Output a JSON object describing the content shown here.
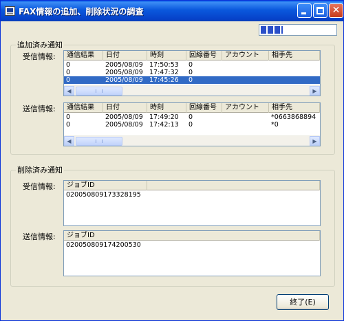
{
  "window": {
    "title": "FAX情報の追加、削除状況の調査"
  },
  "progress": {
    "fraction": 0.3
  },
  "added": {
    "legend": "追加済み通知",
    "received": {
      "label": "受信情報:",
      "columns": [
        "通信結果",
        "日付",
        "時刻",
        "回線番号",
        "アカウント",
        "相手先"
      ],
      "rows": [
        [
          "0",
          "2005/08/09",
          "17:50:53",
          "0",
          "",
          ""
        ],
        [
          "0",
          "2005/08/09",
          "17:47:32",
          "0",
          "",
          ""
        ],
        [
          "0",
          "2005/08/09",
          "17:45:26",
          "0",
          "",
          ""
        ]
      ],
      "selected_row": 2
    },
    "sent": {
      "label": "送信情報:",
      "columns": [
        "通信結果",
        "日付",
        "時刻",
        "回線番号",
        "アカウント",
        "相手先"
      ],
      "rows": [
        [
          "0",
          "2005/08/09",
          "17:49:20",
          "0",
          "",
          "*0663868894"
        ],
        [
          "0",
          "2005/08/09",
          "17:42:13",
          "0",
          "",
          "*0"
        ]
      ]
    }
  },
  "deleted": {
    "legend": "削除済み通知",
    "received": {
      "label": "受信情報:",
      "columns": [
        "ジョブID",
        ""
      ],
      "rows": [
        [
          "020050809173328195",
          ""
        ]
      ]
    },
    "sent": {
      "label": "送信情報:",
      "columns": [
        "ジョブID"
      ],
      "rows": [
        [
          "020050809174200530"
        ]
      ]
    }
  },
  "buttons": {
    "exit": "終了(E)"
  },
  "colors": {
    "titlebar": "#0a58dd",
    "selection": "#316ac5",
    "face": "#ECE9D8"
  }
}
